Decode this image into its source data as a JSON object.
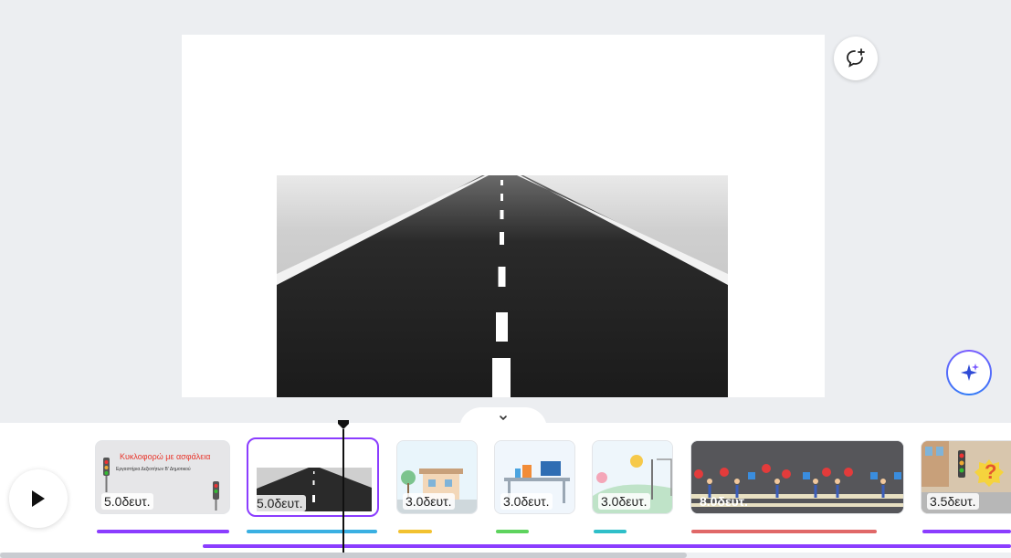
{
  "canvas": {
    "image_alt": "road"
  },
  "buttons": {
    "comment_icon": "comment-add-icon",
    "magic_icon": "sparkle-icon",
    "play_icon": "play-icon",
    "collapse_icon": "chevron-down-icon"
  },
  "clips": [
    {
      "duration": "5.0δευτ.",
      "title": "Κυκλοφορώ με ασφάλεια",
      "subtitle": "Εργαστήρια Δεξιοτήτων Β' Δημοτικού",
      "bar_color": "#8b3dff"
    },
    {
      "duration": "5.0δευτ.",
      "bar_color": "#3ab0e2"
    },
    {
      "duration": "3.0δευτ.",
      "bar_color": "#f2c230"
    },
    {
      "duration": "3.0δευτ.",
      "bar_color": "#5ed35e"
    },
    {
      "duration": "3.0δευτ.",
      "bar_color": "#2fbfc9"
    },
    {
      "duration": "8.0δευτ.",
      "bar_color": "#e06868"
    },
    {
      "duration": "3.5δευτ.",
      "bar_color": "#8b3dff"
    }
  ],
  "help": {
    "label": "?"
  }
}
